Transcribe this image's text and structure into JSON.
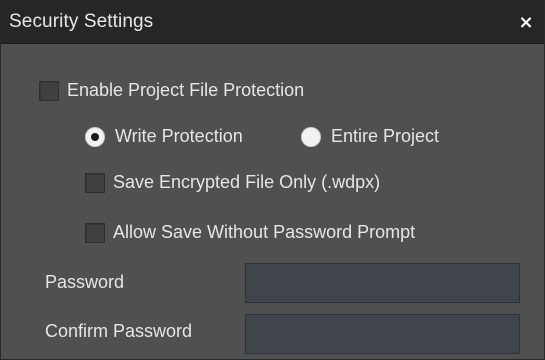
{
  "window": {
    "title": "Security Settings",
    "close_label": "×"
  },
  "options": {
    "enable_protection": {
      "label": "Enable Project File Protection",
      "checked": false
    },
    "mode": {
      "options": [
        {
          "label": "Write Protection",
          "selected": true
        },
        {
          "label": "Entire Project",
          "selected": false
        }
      ]
    },
    "save_encrypted": {
      "label": "Save Encrypted File Only (.wdpx)",
      "checked": false
    },
    "allow_save_without_prompt": {
      "label": "Allow Save Without Password Prompt",
      "checked": false
    }
  },
  "fields": {
    "password": {
      "label": "Password",
      "value": "",
      "placeholder": ""
    },
    "confirm_password": {
      "label": "Confirm Password",
      "value": "",
      "placeholder": ""
    }
  },
  "colors": {
    "titlebar": "#262626",
    "panel": "#505050",
    "input_bg": "#3f454a",
    "text": "#e6e6e6"
  }
}
